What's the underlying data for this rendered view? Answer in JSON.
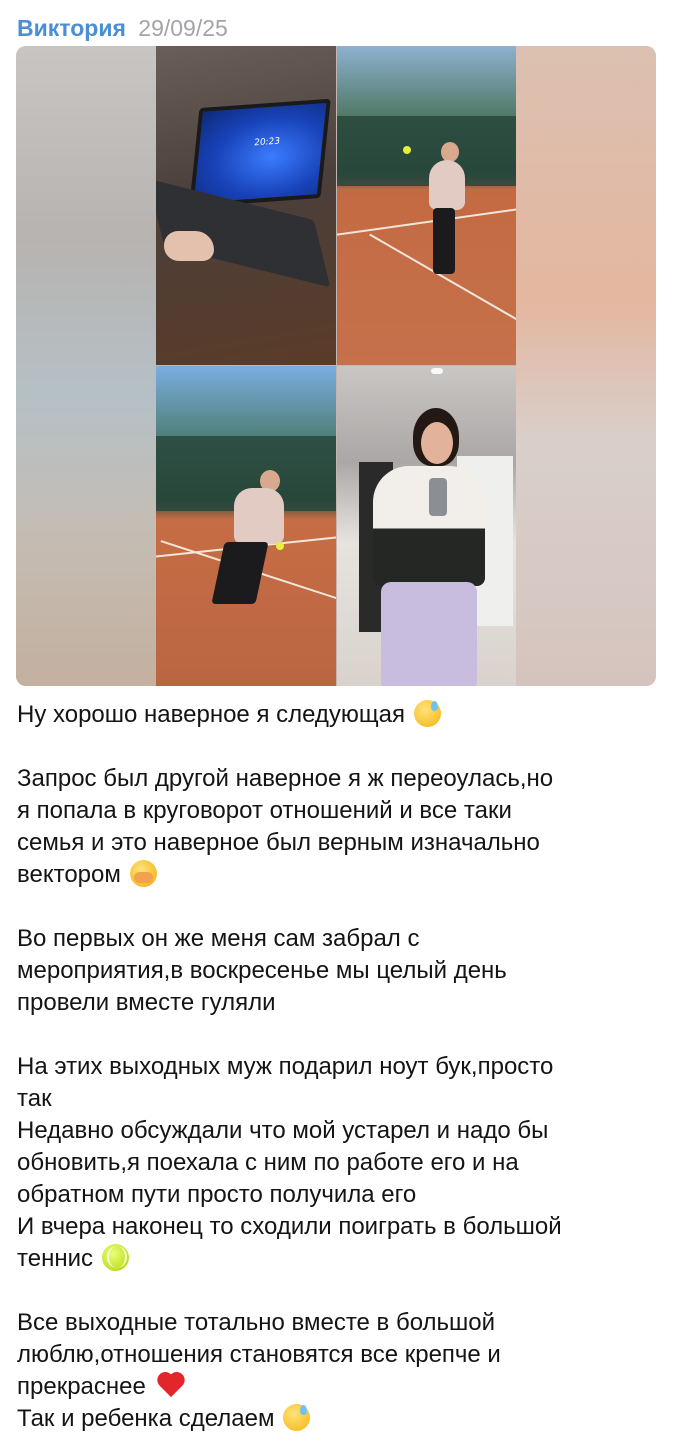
{
  "message": {
    "author": "Виктория",
    "date": "29/09/25",
    "photos": [
      {
        "id": "photo-laptop",
        "clock_text": "20:23"
      },
      {
        "id": "photo-tennis-serve"
      },
      {
        "id": "photo-tennis-racket"
      },
      {
        "id": "photo-mirror-selfie"
      }
    ],
    "paragraphs": [
      "Ну хорошо наверное я следующая",
      "Запрос был другой наверное я ж переоулась,но\nя попала в круговорот отношений и все таки\nсемья и это наверное был верным изначально\nвектором",
      "Во первых он же меня сам забрал с\nмероприятия,в воскресенье мы целый день\nпровели вместе гуляли",
      "На этих выходных муж подарил ноут бук,просто\nтак\nНедавно обсуждали что мой устарел и надо бы\nобновить,я поехала с ним по работе его и на\nобратном пути просто получила его\nИ вчера наконец то сходили поиграть в большой\nтеннис",
      "Все выходные тотально вместе в большой\nлюблю,отношения становятся все крепче и\nпрекраснее",
      "Так и ребенка сделаем"
    ],
    "emojis": [
      "sweat-smile-icon",
      "shocked-face-icon",
      "tennis-ball-icon",
      "red-heart-icon",
      "sweat-smile-icon"
    ]
  }
}
